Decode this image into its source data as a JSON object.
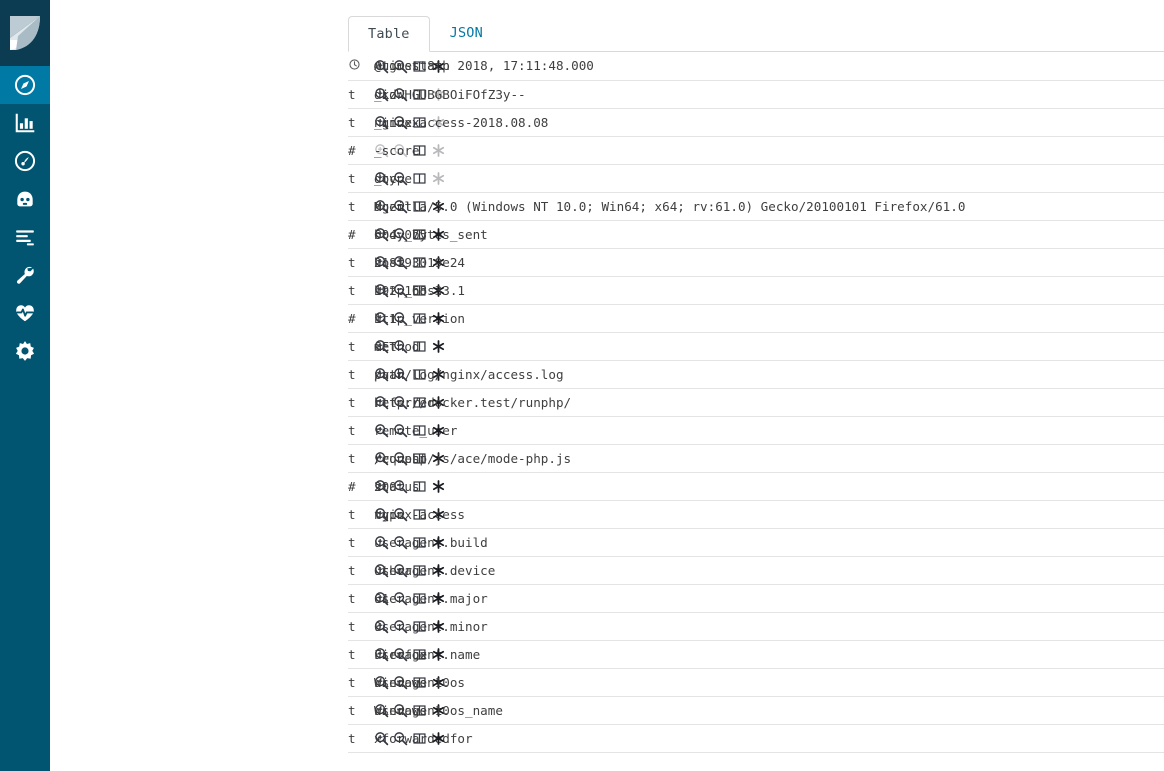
{
  "sidebar": {
    "logo_name": "kibana-logo",
    "items": [
      {
        "name": "discover",
        "icon": "compass-icon",
        "label": "Discover",
        "active": true
      },
      {
        "name": "visualize",
        "icon": "bar-chart-icon",
        "label": "Visualize",
        "active": false
      },
      {
        "name": "dashboard",
        "icon": "dashboard-gauge-icon",
        "label": "Dashboard",
        "active": false
      },
      {
        "name": "apm",
        "icon": "apm-face-icon",
        "label": "APM",
        "active": false
      },
      {
        "name": "logs",
        "icon": "logs-lines-icon",
        "label": "Logs",
        "active": false
      },
      {
        "name": "dev-tools",
        "icon": "wrench-icon",
        "label": "Dev Tools",
        "active": false
      },
      {
        "name": "monitoring",
        "icon": "heart-pulse-icon",
        "label": "Monitoring",
        "active": false
      },
      {
        "name": "management",
        "icon": "gear-icon",
        "label": "Management",
        "active": false
      }
    ]
  },
  "tabs": [
    {
      "label": "Table",
      "active": true
    },
    {
      "label": "JSON",
      "active": false
    }
  ],
  "row_actions": [
    {
      "name": "filter-for-value-button",
      "icon": "magnifier-plus-icon",
      "title": "Filter for value"
    },
    {
      "name": "filter-out-value-button",
      "icon": "magnifier-minus-icon",
      "title": "Filter out value"
    },
    {
      "name": "toggle-column-button",
      "icon": "table-column-icon",
      "title": "Toggle column in table"
    },
    {
      "name": "filter-field-exists-button",
      "icon": "asterisk-icon",
      "title": "Filter for field present"
    }
  ],
  "doc_table": {
    "rows": [
      {
        "type": "date",
        "type_glyph": "",
        "field": "@timestamp",
        "value": "August 8th 2018, 17:11:48.000",
        "actions_enabled": [
          true,
          true,
          true,
          true
        ]
      },
      {
        "type": "string",
        "type_glyph": "t",
        "field": "_id",
        "value": "dkzWHGUBGBOiFOfZ3y--",
        "actions_enabled": [
          true,
          true,
          true,
          false
        ]
      },
      {
        "type": "string",
        "type_glyph": "t",
        "field": "_index",
        "value": "nginx-access-2018.08.08",
        "actions_enabled": [
          true,
          true,
          true,
          false
        ]
      },
      {
        "type": "number",
        "type_glyph": "#",
        "field": "_score",
        "value": "-",
        "actions_enabled": [
          false,
          false,
          true,
          false
        ]
      },
      {
        "type": "string",
        "type_glyph": "t",
        "field": "_type",
        "value": "doc",
        "actions_enabled": [
          true,
          true,
          true,
          false
        ]
      },
      {
        "type": "string",
        "type_glyph": "t",
        "field": "agent",
        "value": "Mozilla/5.0 (Windows NT 10.0; Win64; x64; rv:61.0) Gecko/20100101 Firefox/61.0",
        "actions_enabled": [
          true,
          true,
          true,
          true
        ]
      },
      {
        "type": "number",
        "type_glyph": "#",
        "field": "body_bytes_sent",
        "value": "604,075",
        "actions_enabled": [
          true,
          true,
          true,
          true
        ]
      },
      {
        "type": "string",
        "type_glyph": "t",
        "field": "host",
        "value": "218193019e24",
        "actions_enabled": [
          true,
          true,
          true,
          true
        ]
      },
      {
        "type": "string",
        "type_glyph": "t",
        "field": "http_host",
        "value": "192.168.33.1",
        "actions_enabled": [
          true,
          true,
          true,
          true
        ]
      },
      {
        "type": "number",
        "type_glyph": "#",
        "field": "http_version",
        "value": "1.1",
        "actions_enabled": [
          true,
          true,
          true,
          true
        ]
      },
      {
        "type": "string",
        "type_glyph": "t",
        "field": "method",
        "value": "GET",
        "actions_enabled": [
          true,
          true,
          true,
          true
        ]
      },
      {
        "type": "string",
        "type_glyph": "t",
        "field": "path",
        "value": "/var/log/nginx/access.log",
        "actions_enabled": [
          true,
          true,
          true,
          true
        ]
      },
      {
        "type": "string",
        "type_glyph": "t",
        "field": "referrer",
        "value": "http://docker.test/runphp/",
        "actions_enabled": [
          true,
          true,
          true,
          true
        ]
      },
      {
        "type": "string",
        "type_glyph": "t",
        "field": "remote_user",
        "value": "-",
        "actions_enabled": [
          true,
          true,
          true,
          true
        ]
      },
      {
        "type": "string",
        "type_glyph": "t",
        "field": "request",
        "value": "/runphp/js/ace/mode-php.js",
        "actions_enabled": [
          true,
          true,
          true,
          true
        ]
      },
      {
        "type": "number",
        "type_glyph": "#",
        "field": "status",
        "value": "200",
        "actions_enabled": [
          true,
          true,
          true,
          true
        ]
      },
      {
        "type": "string",
        "type_glyph": "t",
        "field": "type",
        "value": "nginx-access",
        "actions_enabled": [
          true,
          true,
          true,
          true
        ]
      },
      {
        "type": "string",
        "type_glyph": "t",
        "field": "useragent.build",
        "value": "",
        "actions_enabled": [
          true,
          true,
          true,
          true
        ]
      },
      {
        "type": "string",
        "type_glyph": "t",
        "field": "useragent.device",
        "value": "Other",
        "actions_enabled": [
          true,
          true,
          true,
          true
        ]
      },
      {
        "type": "string",
        "type_glyph": "t",
        "field": "useragent.major",
        "value": "61",
        "actions_enabled": [
          true,
          true,
          true,
          true
        ]
      },
      {
        "type": "string",
        "type_glyph": "t",
        "field": "useragent.minor",
        "value": "0",
        "actions_enabled": [
          true,
          true,
          true,
          true
        ]
      },
      {
        "type": "string",
        "type_glyph": "t",
        "field": "useragent.name",
        "value": "Firefox",
        "actions_enabled": [
          true,
          true,
          true,
          true
        ]
      },
      {
        "type": "string",
        "type_glyph": "t",
        "field": "useragent.os",
        "value": "Windows 10",
        "actions_enabled": [
          true,
          true,
          true,
          true
        ]
      },
      {
        "type": "string",
        "type_glyph": "t",
        "field": "useragent.os_name",
        "value": "Windows 10",
        "actions_enabled": [
          true,
          true,
          true,
          true
        ]
      },
      {
        "type": "string",
        "type_glyph": "t",
        "field": "xforwardedfor",
        "value": "-",
        "actions_enabled": [
          true,
          true,
          true,
          true
        ]
      }
    ]
  },
  "colors": {
    "sidebar_bg": "#015571",
    "sidebar_logo_bg": "#0b3c51",
    "sidebar_active_bg": "#0079a5",
    "link": "#0079a5",
    "text": "#3f3f3f",
    "row_border": "#e4e4e4"
  }
}
